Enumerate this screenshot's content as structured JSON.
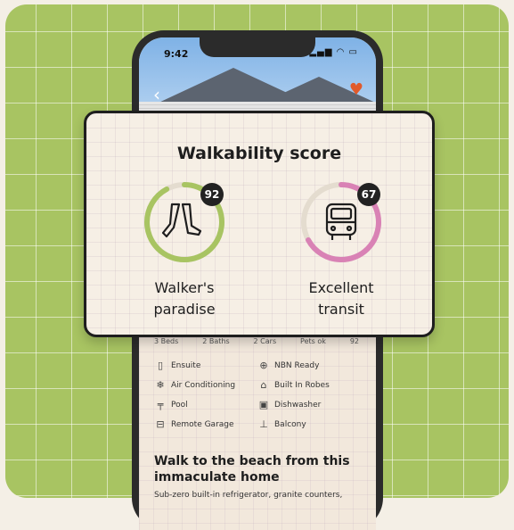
{
  "status_bar": {
    "time": "9:42",
    "icons": "📶 ᯤ ▮"
  },
  "listing": {
    "stats": [
      "3 Beds",
      "2 Baths",
      "2 Cars",
      "Pets ok",
      "92"
    ],
    "features": [
      {
        "icon": "wardrobe-icon",
        "label": "Ensuite"
      },
      {
        "icon": "globe-icon",
        "label": "NBN Ready"
      },
      {
        "icon": "snowflake-icon",
        "label": "Air Conditioning"
      },
      {
        "icon": "hanger-icon",
        "label": "Built In Robes"
      },
      {
        "icon": "pool-ladder-icon",
        "label": "Pool"
      },
      {
        "icon": "dishwasher-icon",
        "label": "Dishwasher"
      },
      {
        "icon": "garage-icon",
        "label": "Remote Garage"
      },
      {
        "icon": "balcony-icon",
        "label": "Balcony"
      }
    ],
    "headline": "Walk to the beach from this immaculate home",
    "description": "Sub-zero built-in refrigerator, granite counters,"
  },
  "walkability": {
    "title": "Walkability score",
    "scores": [
      {
        "value": "92",
        "label_line1": "Walker's",
        "label_line2": "paradise",
        "percent": 0.92,
        "color": "#a8c462",
        "icon": "walking-legs-icon"
      },
      {
        "value": "67",
        "label_line1": "Excellent",
        "label_line2": "transit",
        "percent": 0.67,
        "color": "#d982b5",
        "icon": "bus-icon"
      }
    ]
  },
  "colors": {
    "background": "#a8c462",
    "card": "#f6efe5",
    "dark": "#1e1e1e"
  }
}
